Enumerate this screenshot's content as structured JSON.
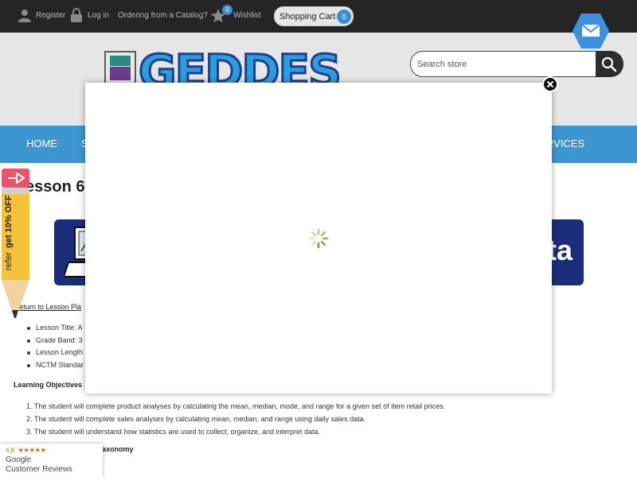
{
  "topbar": {
    "register_label": "Register",
    "login_label": "Log in",
    "catalog_label": "Ordering from a Catalog?",
    "wishlist_label": "Wishlist",
    "wishlist_count": "0",
    "cart_label": "Shopping Cart",
    "cart_count": "0"
  },
  "header": {
    "logo_text": "GEDDES",
    "search_placeholder": "Search store"
  },
  "nav": {
    "items": [
      "HOME",
      "S",
      "RVICES"
    ]
  },
  "page": {
    "title": "esson 6:",
    "banner_word": "ta",
    "back_link": "Return to Lesson Pla",
    "details": [
      "Lesson Title: A",
      "Grade Band: 3",
      "Lesson Length",
      "NCTM Standar"
    ],
    "objectives_heading": "Learning Objectives",
    "objectives": [
      "1. The student will complete product analyses by calculating the mean, median, mode, and range for a given set of item retail prices.",
      "2. The student will complete sales analyses by calculating mean, median, and range using daily sales data.",
      "3. The student will understand how statistics are used to collect, organize, and interpret data."
    ],
    "taxonomy_heading": "axonomy"
  },
  "referral": {
    "text_a": "refer",
    "text_b": "get 10% OFF"
  },
  "google_reviews": {
    "rating": "4.8",
    "stars": "★★★★★",
    "name": "Google",
    "subtitle": "Customer Reviews"
  },
  "colors": {
    "topbar": "#252525",
    "nav": "#3d96d0",
    "badge": "#3b8fd4",
    "banner": "#1a2d7a"
  }
}
